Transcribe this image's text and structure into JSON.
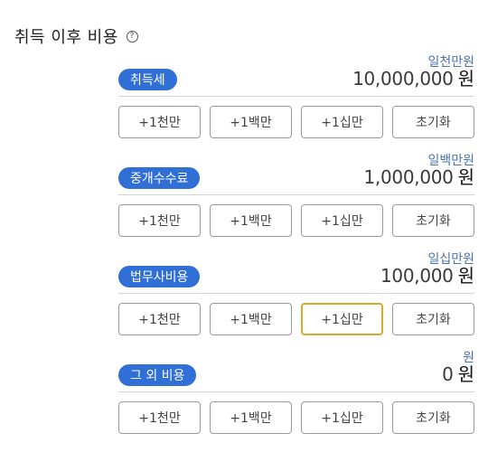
{
  "section": {
    "title": "취득 이후 비용",
    "help_glyph": "?"
  },
  "items": [
    {
      "label": "취득세",
      "hangul_amount": "일천만원",
      "amount": "10,000,000",
      "unit": "원",
      "buttons": [
        "+1천만",
        "+1백만",
        "+1십만",
        "초기화"
      ]
    },
    {
      "label": "중개수수료",
      "hangul_amount": "일백만원",
      "amount": "1,000,000",
      "unit": "원",
      "buttons": [
        "+1천만",
        "+1백만",
        "+1십만",
        "초기화"
      ]
    },
    {
      "label": "법무사비용",
      "hangul_amount": "일십만원",
      "amount": "100,000",
      "unit": "원",
      "buttons": [
        "+1천만",
        "+1백만",
        "+1십만",
        "초기화"
      ]
    },
    {
      "label": "그 외 비용",
      "hangul_amount": "원",
      "amount": "0",
      "unit": "원",
      "buttons": [
        "+1천만",
        "+1백만",
        "+1십만",
        "초기화"
      ]
    }
  ],
  "colors": {
    "badge": "#2f6fd6",
    "hangul_text": "#4a72b0",
    "focus_ring": "#d8a92c"
  },
  "icons": {
    "help": "question-circle-icon"
  }
}
